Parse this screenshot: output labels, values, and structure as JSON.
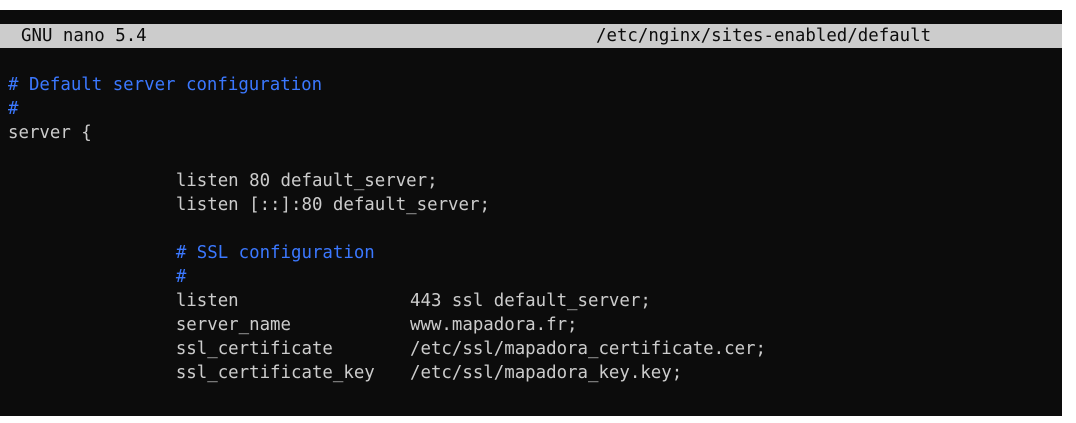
{
  "nano": {
    "app_title": "GNU nano 5.4",
    "file_path": "/etc/nginx/sites-enabled/default"
  },
  "colors": {
    "terminal_bg": "#0c0c0c",
    "text": "#cccccc",
    "comment": "#3b78ff",
    "titlebar_bg": "#cccccc"
  },
  "lines": {
    "l1": "# Default server configuration",
    "l2": "#",
    "l3": "server {",
    "l4": "listen 80 default_server;",
    "l5": "listen [::]:80 default_server;",
    "l6": "",
    "l7": "# SSL configuration",
    "l8": "#",
    "l9_key": "listen",
    "l9_val": "443 ssl default_server;",
    "l10_key": "server_name",
    "l10_val": "www.mapadora.fr;",
    "l11_key": "ssl_certificate",
    "l11_val": "/etc/ssl/mapadora_certificate.cer;",
    "l12_key": "ssl_certificate_key",
    "l12_val": "/etc/ssl/mapadora_key.key;"
  }
}
